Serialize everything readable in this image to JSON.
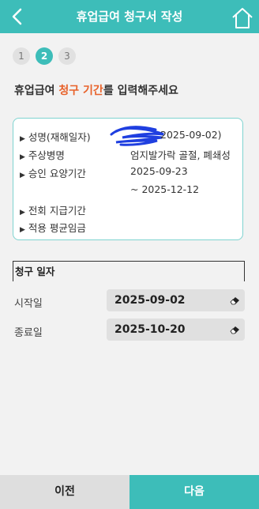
{
  "header": {
    "title": "휴업급여 청구서 작성",
    "back_icon": "chevron-left-icon",
    "home_icon": "home-icon"
  },
  "steps": [
    "1",
    "2",
    "3"
  ],
  "active_step": "2",
  "prompt": {
    "part1": "휴업급여 ",
    "highlight": "청구 기간",
    "part2": "를 입력해주세요"
  },
  "info": {
    "name_label": "성명(재해일자)",
    "name_value": "2025-09-02)",
    "injury_label": "주상병명",
    "injury_value": "엄지발가락 골절, 폐쇄성",
    "treatment_label": "승인 요양기간",
    "treatment_start": "2025-09-23",
    "treatment_end": "~  2025-12-12",
    "prev_pay_label": "전회 지급기간",
    "avg_wage_label": "적용 평균임금"
  },
  "claim": {
    "section_title": "청구 일자",
    "start_label": "시작일",
    "start_value": "2025-09-02",
    "end_label": "종료일",
    "end_value": "2025-10-20"
  },
  "footer": {
    "prev_label": "이전",
    "next_label": "다음"
  },
  "colors": {
    "accent": "#3dbdb9",
    "highlight": "#e8622a",
    "scribble": "#1f3fe0"
  }
}
